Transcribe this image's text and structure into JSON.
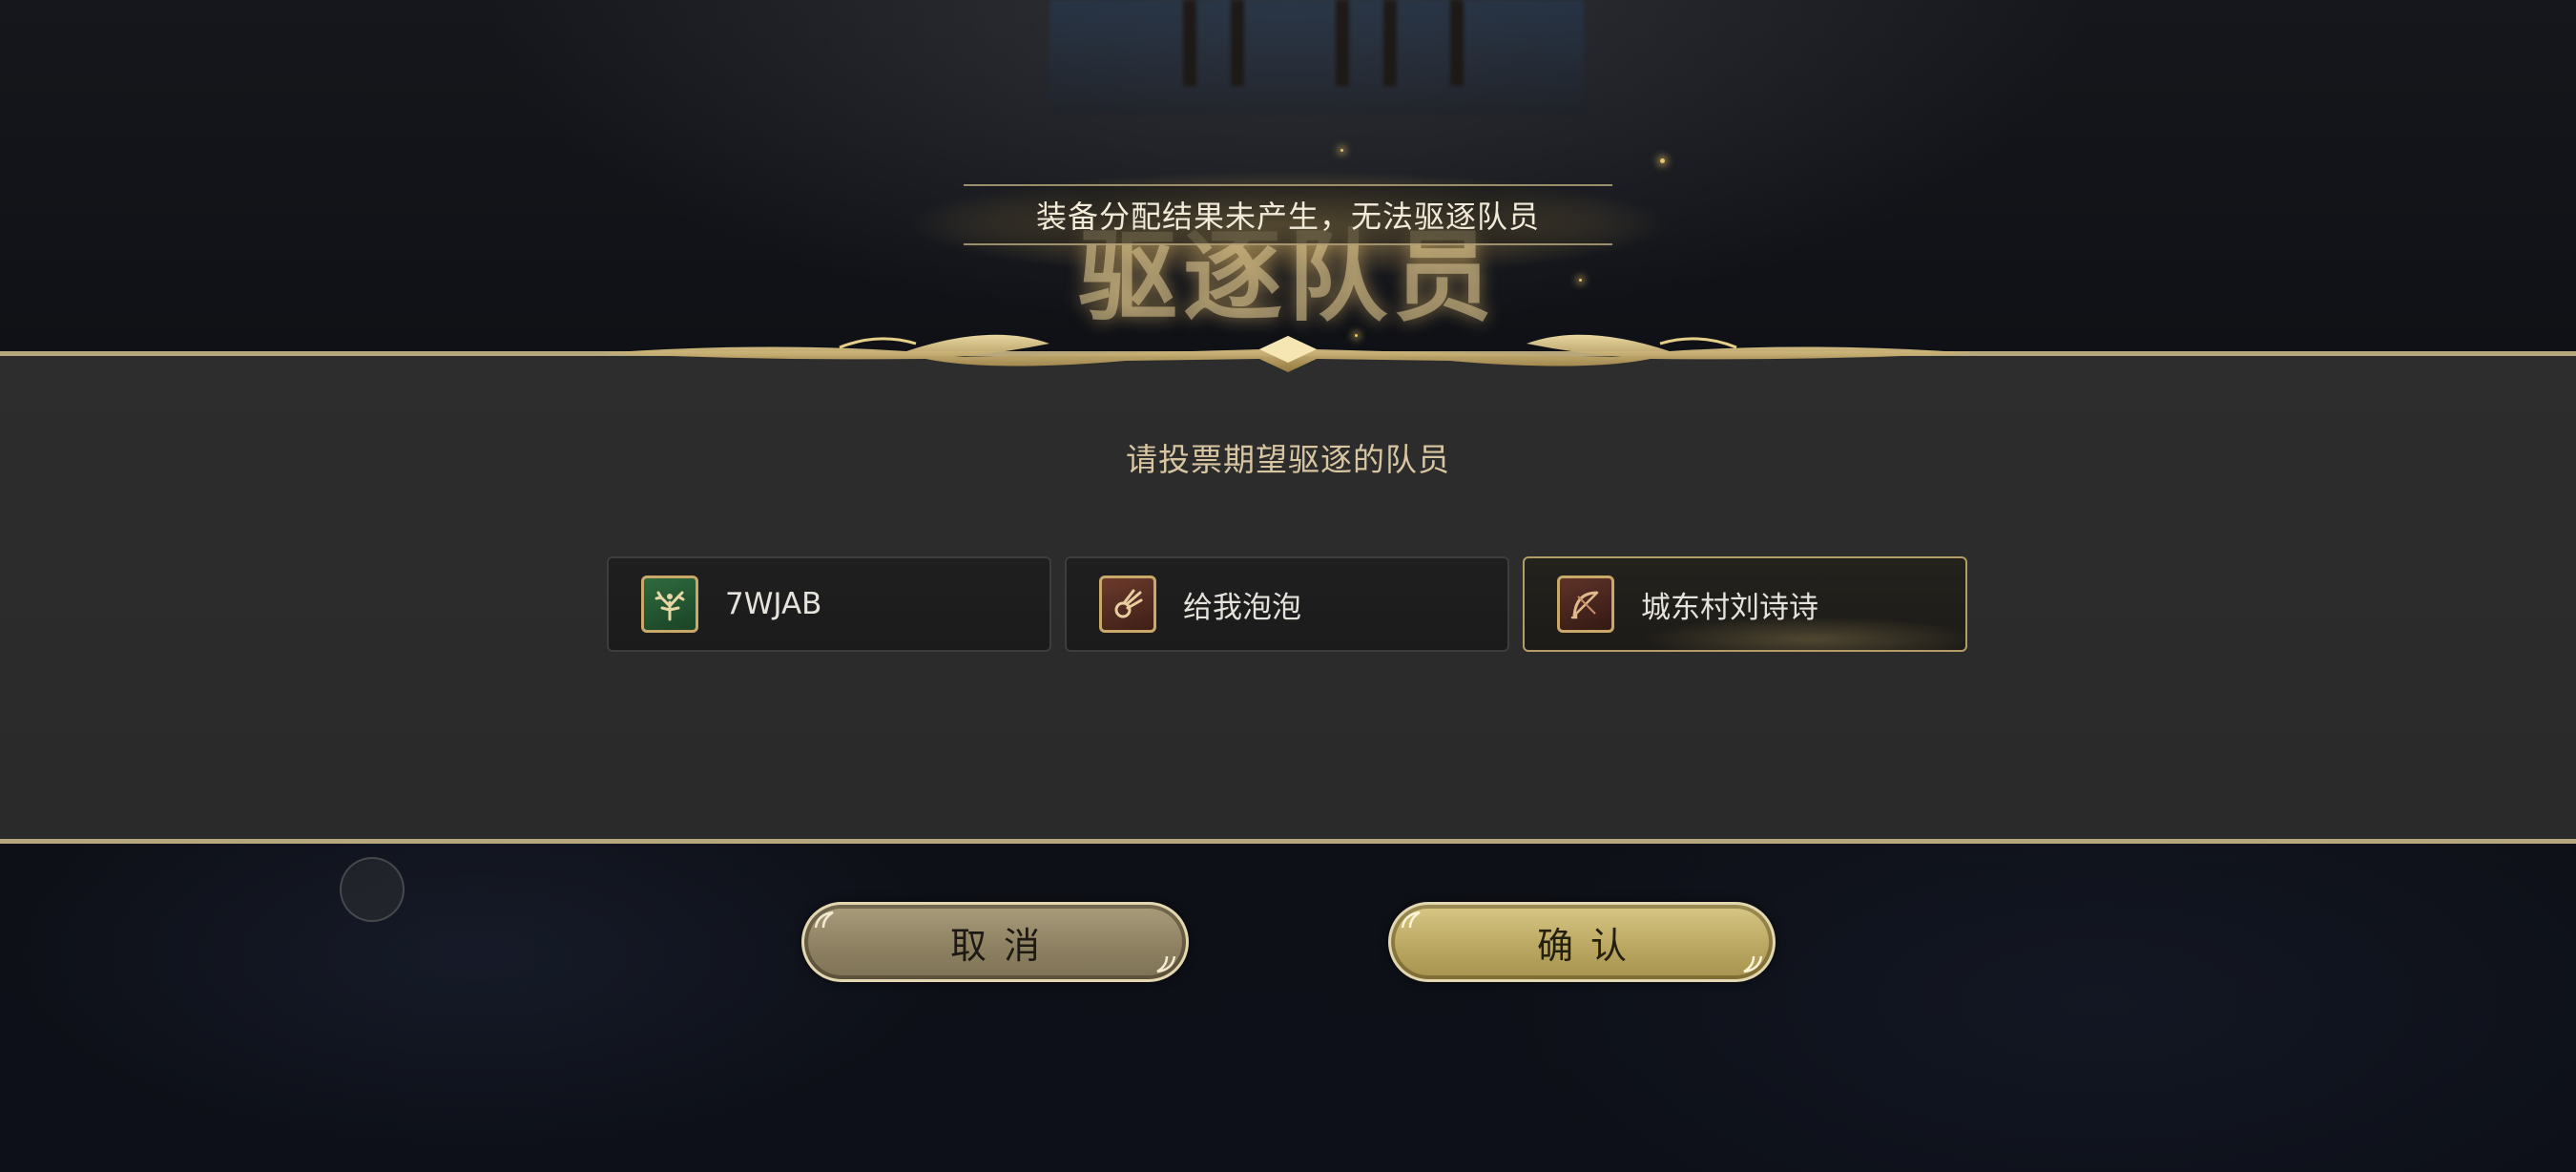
{
  "dialog": {
    "title_ghost": "驱逐队员",
    "notice": "装备分配结果未产生，无法驱逐队员",
    "prompt": "请投票期望驱逐的队员"
  },
  "players": [
    {
      "name": "7WJAB",
      "class_icon": "tree-class-icon",
      "selected": false
    },
    {
      "name": "给我泡泡",
      "class_icon": "fireball-class-icon",
      "selected": false
    },
    {
      "name": "城东村刘诗诗",
      "class_icon": "bow-class-icon",
      "selected": true
    }
  ],
  "buttons": {
    "cancel": "取消",
    "confirm": "确认"
  },
  "colors": {
    "accent_gold": "#b7a77c",
    "panel_bg": "#2d2d2d",
    "prompt_text": "#d7c6a1"
  }
}
